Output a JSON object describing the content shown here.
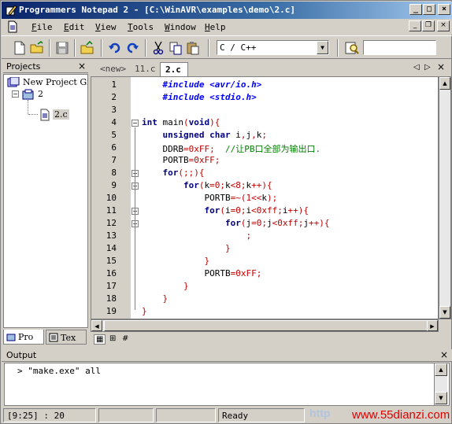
{
  "window": {
    "title": "Programmers Notepad 2 - [C:\\WinAVR\\examples\\demo\\2.c]"
  },
  "menu": [
    "File",
    "Edit",
    "View",
    "Tools",
    "Window",
    "Help"
  ],
  "menu_underline": [
    "F",
    "E",
    "V",
    "T",
    "W",
    "H"
  ],
  "toolbar": {
    "language": "C / C++"
  },
  "projects": {
    "title": "Projects",
    "tree": [
      "New Project Gr",
      "2",
      "2.c"
    ],
    "tabs": [
      "Pro",
      "Tex"
    ]
  },
  "editor": {
    "tabs": [
      "<new>",
      "11.c",
      "2.c"
    ],
    "line_numbers": [
      "1",
      "2",
      "3",
      "4",
      "5",
      "6",
      "7",
      "8",
      "9",
      "10",
      "11",
      "12",
      "13",
      "14",
      "15",
      "16",
      "17",
      "18",
      "19"
    ],
    "lines": [
      "    #include <avr/io.h>",
      "    #include <stdio.h>",
      "",
      "int main(void){",
      "    unsigned char i,j,k;",
      "    DDRB=0xFF;  //让PB口全部为输出口.",
      "    PORTB=0xFF;",
      "    for(;;){",
      "        for(k=0;k<8;k++){",
      "            PORTB=~(1<<k);",
      "            for(i=0;i<0xff;i++){",
      "                for(j=0;j<0xff;j++){",
      "                    ;",
      "                }",
      "            }",
      "            PORTB=0xFF;",
      "        }",
      "    }",
      "}"
    ]
  },
  "output": {
    "title": "Output",
    "lines": [
      "> \"make.exe\" all"
    ]
  },
  "status": {
    "position": "[9:25] : 20",
    "state": "Ready",
    "watermark": "www.55dianzi.com",
    "watermark_prefix": "http"
  },
  "colors": {
    "titlebar_start": "#0a246a",
    "titlebar_end": "#a6caf0",
    "keyword": "#000080",
    "preprocessor": "#0000ff",
    "operator": "#c00000",
    "comment": "#008000"
  }
}
